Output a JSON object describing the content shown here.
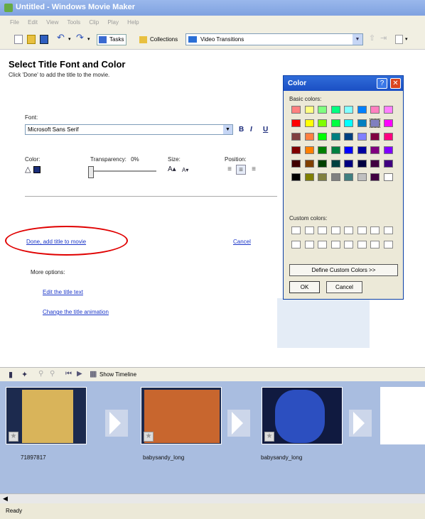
{
  "window": {
    "title": "Untitled - Windows Movie Maker"
  },
  "menu": [
    "File",
    "Edit",
    "View",
    "Tools",
    "Clip",
    "Play",
    "Help"
  ],
  "toolbar": {
    "tasks_label": "Tasks",
    "collections_label": "Collections",
    "collection_value": "Video Transitions"
  },
  "panel": {
    "heading": "Select Title Font and Color",
    "subheading": "Click 'Done' to add the title to the movie.",
    "font_label": "Font:",
    "font_value": "Microsoft Sans Serif",
    "bold": "B",
    "italic": "I",
    "underline": "U",
    "color_label": "Color:",
    "transparency_label": "Transparency:",
    "transparency_value": "0%",
    "size_label": "Size:",
    "position_label": "Position:",
    "done_link": "Done, add title to movie",
    "cancel_link": "Cancel",
    "more_options": "More options:",
    "edit_text_link": "Edit the title text",
    "change_anim_link": "Change the title animation"
  },
  "color_dialog": {
    "title": "Color",
    "basic_label": "Basic colors:",
    "custom_label": "Custom colors:",
    "define_button": "Define Custom Colors >>",
    "ok_button": "OK",
    "cancel_button": "Cancel",
    "basic_colors": [
      "#ff8080",
      "#ffff80",
      "#80ff80",
      "#00ff80",
      "#80ffff",
      "#0080ff",
      "#ff80c0",
      "#ff80ff",
      "#ff0000",
      "#ffff00",
      "#80ff00",
      "#00ff40",
      "#00ffff",
      "#0080c0",
      "#8080c0",
      "#ff00ff",
      "#804040",
      "#ff8040",
      "#00ff00",
      "#008080",
      "#004080",
      "#8080ff",
      "#800040",
      "#ff0080",
      "#800000",
      "#ff8000",
      "#008000",
      "#008040",
      "#0000ff",
      "#0000a0",
      "#800080",
      "#8000ff",
      "#400000",
      "#804000",
      "#004000",
      "#004040",
      "#000080",
      "#000040",
      "#400040",
      "#400080",
      "#000000",
      "#808000",
      "#808040",
      "#808080",
      "#408080",
      "#c0c0c0",
      "#400040",
      "#ffffff"
    ]
  },
  "storyboard": {
    "show_timeline": "Show Timeline",
    "clips": [
      {
        "label": "71897817"
      },
      {
        "label": "babysandy_long"
      },
      {
        "label": "babysandy_long"
      }
    ]
  },
  "status": {
    "text": "Ready"
  }
}
